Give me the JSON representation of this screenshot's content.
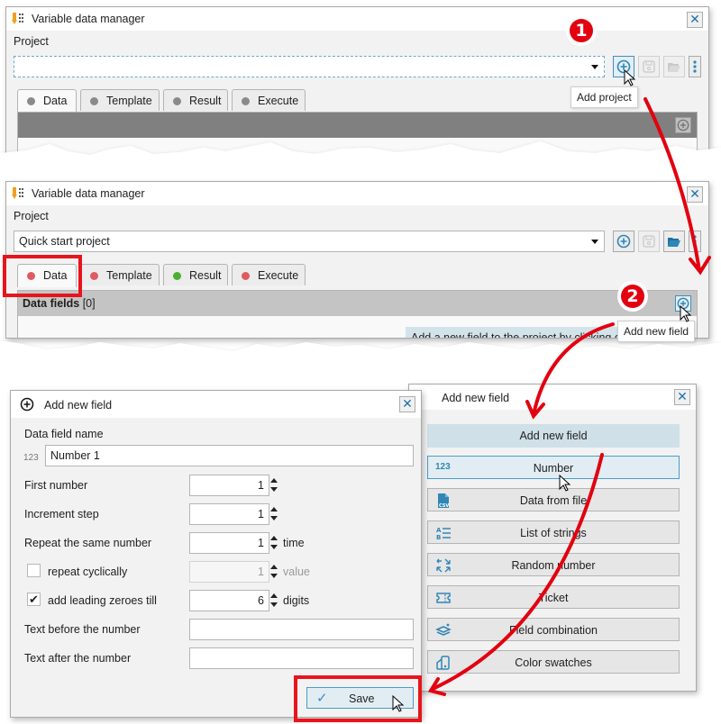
{
  "window1": {
    "title": "Variable data manager",
    "project_label": "Project",
    "project_value": "",
    "tabs": [
      {
        "label": "Data",
        "status_color": "#8a8a8a"
      },
      {
        "label": "Template",
        "status_color": "#8a8a8a"
      },
      {
        "label": "Result",
        "status_color": "#8a8a8a"
      },
      {
        "label": "Execute",
        "status_color": "#8a8a8a"
      }
    ],
    "tooltip": "Add project"
  },
  "window2": {
    "title": "Variable data manager",
    "project_label": "Project",
    "project_value": "Quick start project",
    "tabs": [
      {
        "label": "Data",
        "status_color": "#e05a5f"
      },
      {
        "label": "Template",
        "status_color": "#e05a5f"
      },
      {
        "label": "Result",
        "status_color": "#4caf35"
      },
      {
        "label": "Execute",
        "status_color": "#e05a5f"
      }
    ],
    "data_fields_title": "Data fields",
    "data_fields_count": "[0]",
    "hint_text": "Add a new field to the project by clicking on",
    "tooltip": "Add new field"
  },
  "steps": {
    "step1": "1",
    "step2": "2"
  },
  "field_types_dialog": {
    "title": "Add new field",
    "header": "Add new field",
    "items": [
      {
        "label": "Number",
        "icon": "number-123-icon",
        "glyph": "123"
      },
      {
        "label": "Data from file",
        "icon": "csv-file-icon",
        "glyph": "CSV"
      },
      {
        "label": "List of strings",
        "icon": "list-icon",
        "glyph": "A☰"
      },
      {
        "label": "Random number",
        "icon": "random-arrows-icon",
        "glyph": "⤡"
      },
      {
        "label": "Ticket",
        "icon": "ticket-icon",
        "glyph": "🎫"
      },
      {
        "label": "Field combination",
        "icon": "layers-icon",
        "glyph": "≋"
      },
      {
        "label": "Color swatches",
        "icon": "swatches-icon",
        "glyph": "◧"
      }
    ]
  },
  "number_dialog": {
    "title": "Add new field",
    "field_name_label": "Data field name",
    "field_type_glyph": "123",
    "field_name_value": "Number 1",
    "first_number_label": "First number",
    "first_number_value": "1",
    "increment_label": "Increment step",
    "increment_value": "1",
    "repeat_label": "Repeat the same number",
    "repeat_value": "1",
    "repeat_unit": "time",
    "cyclic_label": "repeat cyclically",
    "cyclic_checked": false,
    "cyclic_value": "1",
    "cyclic_unit": "value",
    "zeroes_label": "add leading zeroes till",
    "zeroes_checked": true,
    "zeroes_value": "6",
    "zeroes_unit": "digits",
    "text_before_label": "Text before the number",
    "text_before_value": "",
    "text_after_label": "Text after the number",
    "text_after_value": "",
    "save_label": "Save"
  },
  "colors": {
    "accent": "#3186b5",
    "annotation_red": "#e3000f",
    "tab_red": "#e05a5f",
    "tab_green": "#4caf35"
  }
}
